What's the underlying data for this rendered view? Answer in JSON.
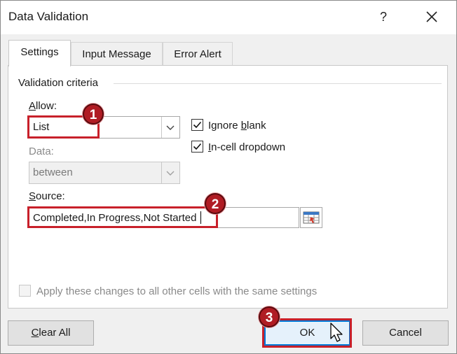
{
  "dialog": {
    "title": "Data Validation",
    "help_glyph": "?"
  },
  "tabs": [
    {
      "label": "Settings",
      "active": true
    },
    {
      "label": "Input Message",
      "active": false
    },
    {
      "label": "Error Alert",
      "active": false
    }
  ],
  "criteria": {
    "group_label": "Validation criteria",
    "allow": {
      "label_prefix": "",
      "label_key": "A",
      "label_rest": "llow:",
      "value": "List"
    },
    "data": {
      "label": "Data:",
      "value": "between",
      "disabled": true
    },
    "ignore_blank": {
      "label_pre": "Ignore ",
      "label_key": "b",
      "label_post": "lank",
      "checked": true
    },
    "in_cell_dropdown": {
      "label_key": "I",
      "label_post": "n-cell dropdown",
      "checked": true
    },
    "source": {
      "label_key": "S",
      "label_rest": "ource:",
      "value": "Completed,In Progress,Not Started"
    }
  },
  "apply_all": {
    "label": "Apply these changes to all other cells with the same settings",
    "checked": false,
    "disabled": true
  },
  "buttons": {
    "clear_all_key": "C",
    "clear_all_rest": "lear All",
    "ok": "OK",
    "cancel": "Cancel"
  },
  "annotations": {
    "step1": "1",
    "step2": "2",
    "step3": "3",
    "color": "#c8202a"
  }
}
